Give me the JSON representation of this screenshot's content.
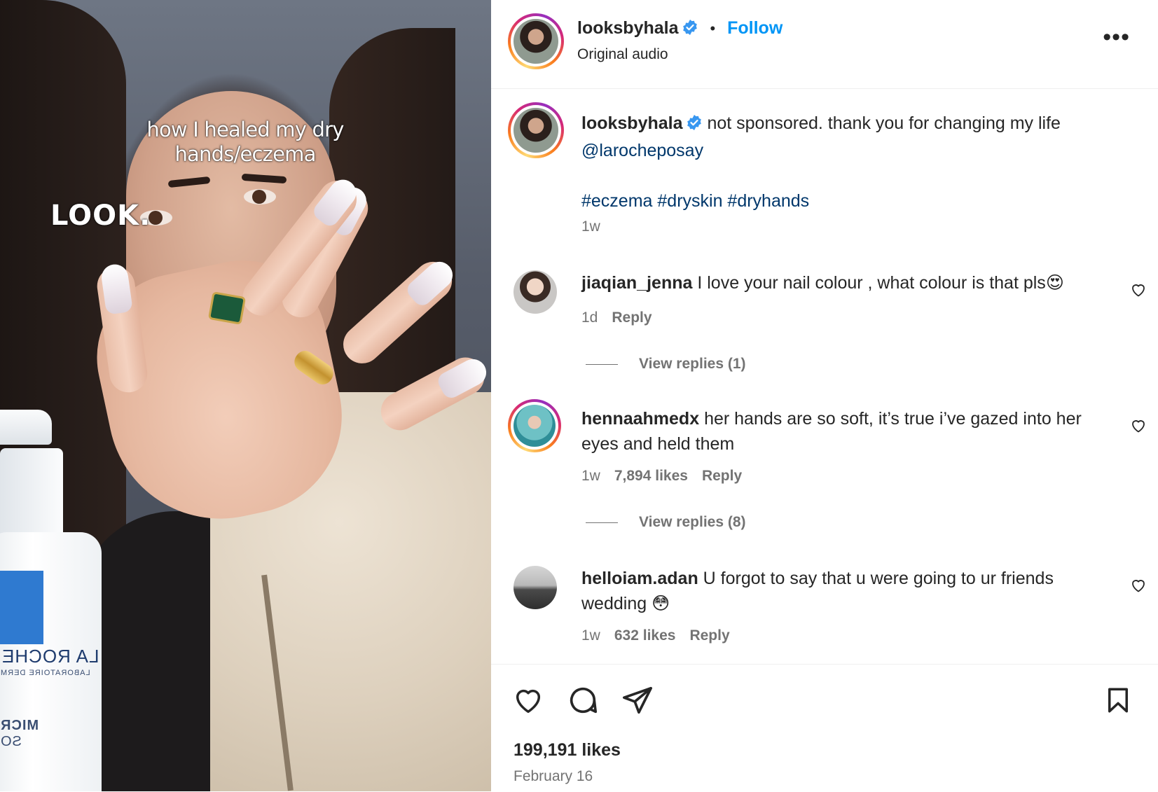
{
  "media": {
    "overlay_title": "how I healed my dry hands/eczema",
    "overlay_look": "LOOK.",
    "bottle_brand": "LA ROCHE",
    "bottle_sub": "LABORATOIRE DERM",
    "bottle_text3": "MICR",
    "bottle_text4": "SO"
  },
  "header": {
    "username": "looksbyhala",
    "follow_label": "Follow",
    "audio": "Original audio",
    "more_icon": "more-horizontal-icon"
  },
  "caption": {
    "username": "looksbyhala",
    "text": "not sponsored. thank you for changing my life",
    "mention": "@larocheposay",
    "hashtags": "#eczema #dryskin #dryhands",
    "time": "1w"
  },
  "comments": [
    {
      "username": "jiaqian_jenna",
      "text": "I love your nail colour , what colour is that pls",
      "emoji": "😍",
      "time": "1d",
      "likes": "",
      "reply_label": "Reply",
      "view_replies": "View replies (1)"
    },
    {
      "username": "hennaahmedx",
      "text": "her hands are so soft, it’s true i’ve gazed into her eyes and held them",
      "emoji": "",
      "time": "1w",
      "likes": "7,894 likes",
      "reply_label": "Reply",
      "view_replies": "View replies (8)"
    },
    {
      "username": "helloiam.adan",
      "text": "U forgot to say that u were going to ur friends wedding",
      "emoji": "😳",
      "time": "1w",
      "likes": "632 likes",
      "reply_label": "Reply",
      "view_replies": ""
    }
  ],
  "footer": {
    "likes": "199,191 likes",
    "date": "February 16"
  },
  "colors": {
    "accent": "#0095f6",
    "verified": "#3897f0",
    "text": "#262626",
    "muted": "#737373",
    "link": "#00376b"
  }
}
